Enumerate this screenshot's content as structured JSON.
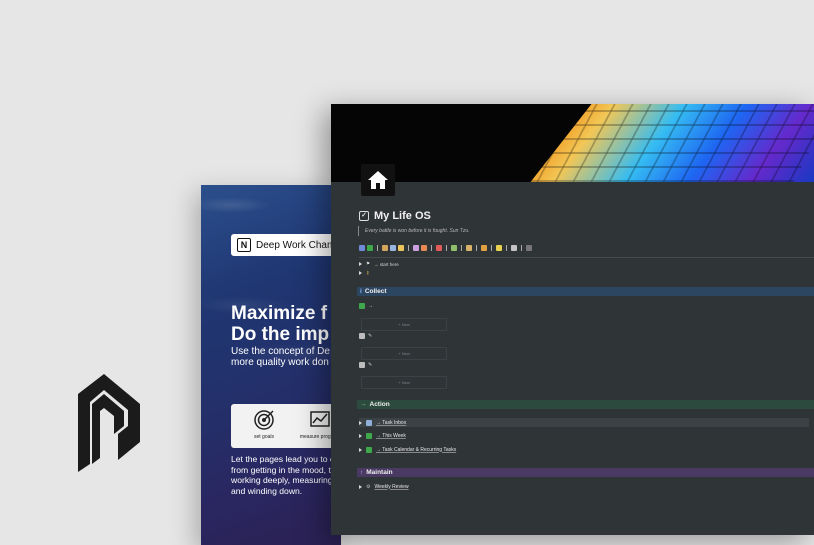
{
  "back_card": {
    "pill_text": "Deep Work Chamb",
    "hero_title_line1": "Maximize f",
    "hero_title_line2": "Do the imp",
    "hero_sub_line1": "Use the concept of De",
    "hero_sub_line2": "more quality work don",
    "features": [
      {
        "label": "set goals",
        "icon": "target-icon"
      },
      {
        "label": "measure progress",
        "icon": "chart-icon"
      }
    ],
    "body_lines": [
      "Let the pages lead you to e",
      "from getting in the mood, t",
      "working deeply, measuring",
      "and winding down."
    ]
  },
  "front_card": {
    "title": "My Life OS",
    "quote": "Every battle is won before it is fought. Sun Tzu.",
    "toggle_1": "→ start here",
    "sections": {
      "collect": {
        "label": "Collect",
        "color": "#2c4661",
        "new_label": "+ New",
        "sub_arrow": "→"
      },
      "action": {
        "label": "Action",
        "prefix": "→",
        "color": "#2c4a3d",
        "items": [
          "→ Task Inbox",
          "→ This Week",
          "→ Task Calendar & Recurring Tasks"
        ]
      },
      "maintain": {
        "label": "Maintain",
        "prefix": "↑",
        "color": "#4a3a63",
        "items": [
          "Weekly Review"
        ]
      }
    }
  },
  "colors": {
    "bg": "#e6e6e6",
    "page_bg": "#2f3437",
    "accent_green": "#3fa84a"
  }
}
